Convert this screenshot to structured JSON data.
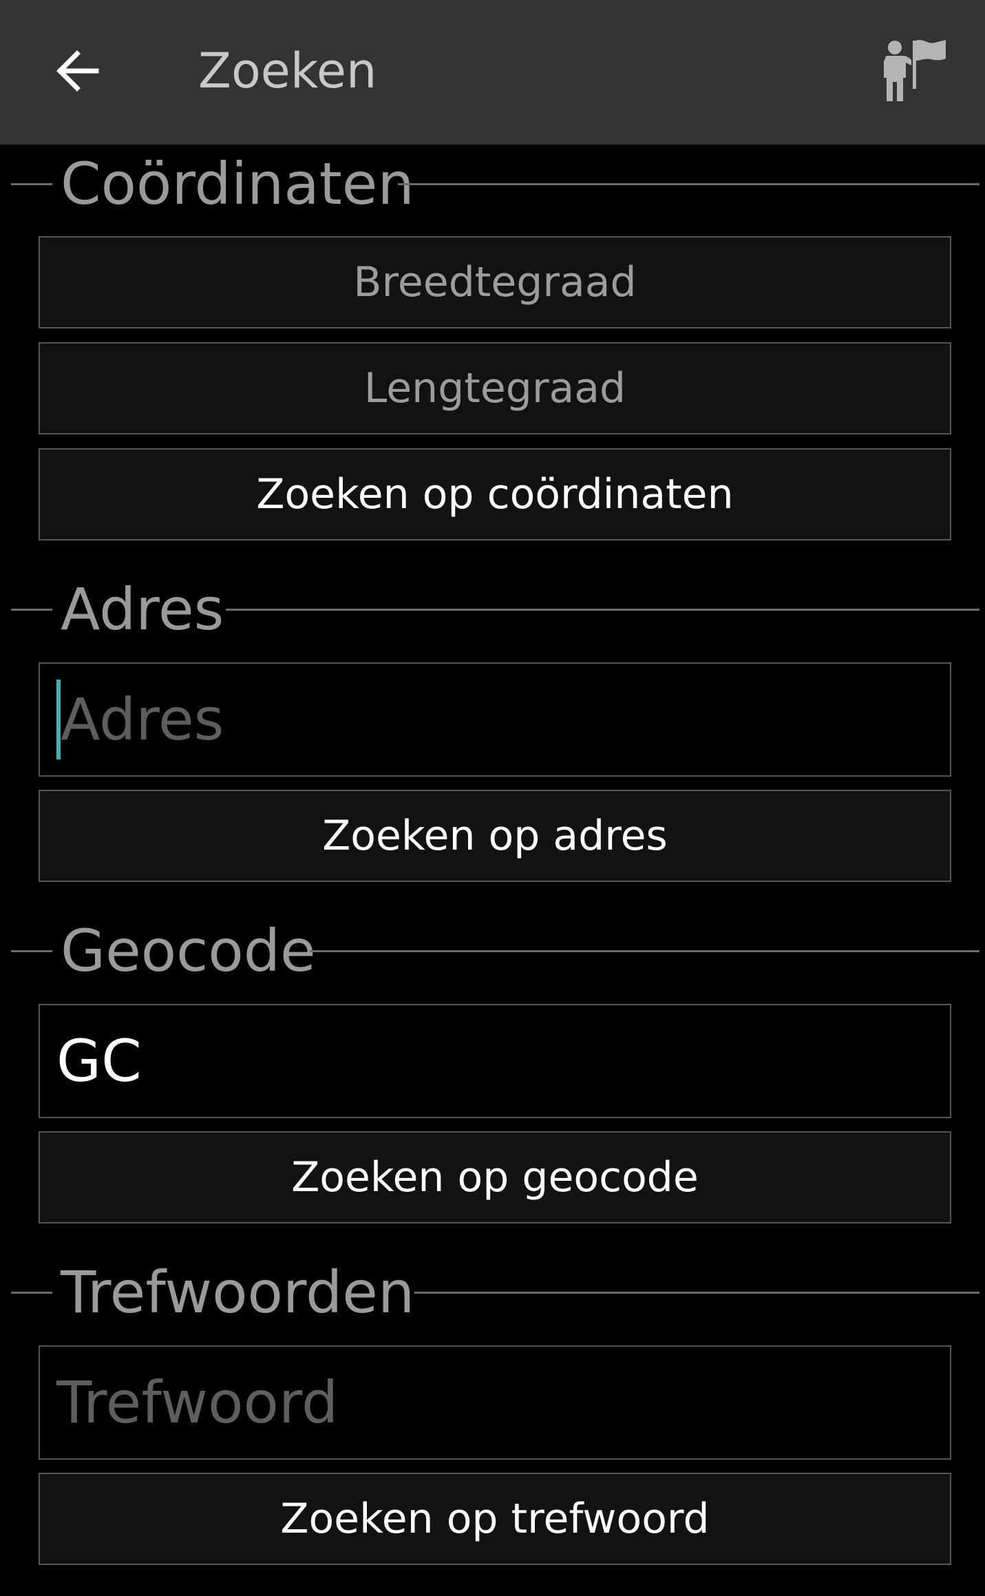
{
  "toolbar": {
    "title": "Zoeken",
    "back_icon": "arrow-left-icon",
    "poi_icon": "person-flag-icon"
  },
  "coordinates": {
    "header": "Coördinaten",
    "latitude_label": "Breedtegraad",
    "longitude_label": "Lengtegraad",
    "search_button": "Zoeken op coördinaten"
  },
  "address": {
    "header": "Adres",
    "input_placeholder": "Adres",
    "input_value": "",
    "search_button": "Zoeken op adres"
  },
  "geocode": {
    "header": "Geocode",
    "input_value": "GC",
    "search_button": "Zoeken op geocode"
  },
  "keywords": {
    "header": "Trefwoorden",
    "input_placeholder": "Trefwoord",
    "input_value": "",
    "search_button": "Zoeken op trefwoord"
  },
  "colors": {
    "toolbar_bg": "#333333",
    "background": "#000000",
    "cursor": "#3fb0b0"
  }
}
